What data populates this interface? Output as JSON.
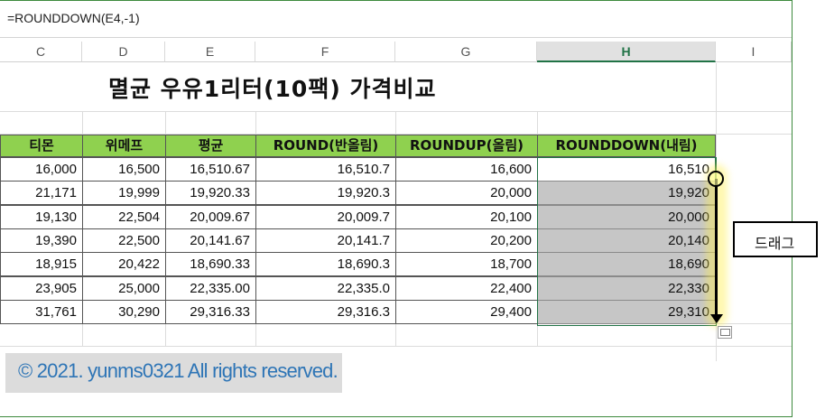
{
  "formula_bar": {
    "text": "=ROUNDDOWN(E4,-1)"
  },
  "columns": [
    {
      "letter": "C"
    },
    {
      "letter": "D"
    },
    {
      "letter": "E"
    },
    {
      "letter": "F"
    },
    {
      "letter": "G"
    },
    {
      "letter": "H",
      "active": true
    },
    {
      "letter": "I"
    }
  ],
  "sheet_title": "멸균 우유1리터(10팩) 가격비교",
  "table": {
    "headers": [
      "티몬",
      "위메프",
      "평균",
      "ROUND(반올림)",
      "ROUNDUP(올림)",
      "ROUNDDOWN(내림)"
    ],
    "rows": [
      [
        "16,000",
        "16,500",
        "16,510.67",
        "16,510.7",
        "16,600",
        "16,510"
      ],
      [
        "21,171",
        "19,999",
        "19,920.33",
        "19,920.3",
        "20,000",
        "19,920"
      ],
      [
        "19,130",
        "22,504",
        "20,009.67",
        "20,009.7",
        "20,100",
        "20,000"
      ],
      [
        "19,390",
        "22,500",
        "20,141.67",
        "20,141.7",
        "20,200",
        "20,140"
      ],
      [
        "18,915",
        "20,422",
        "18,690.33",
        "18,690.3",
        "18,700",
        "18,690"
      ],
      [
        "23,905",
        "25,000",
        "22,335.00",
        "22,335.0",
        "22,400",
        "22,330"
      ],
      [
        "31,761",
        "30,290",
        "29,316.33",
        "29,316.3",
        "29,400",
        "29,310"
      ]
    ]
  },
  "annotation": {
    "callout_text": "드래그"
  },
  "copyright": "© 2021. yunms0321 All rights reserved.",
  "colors": {
    "header_green": "#8fd14f",
    "excel_green": "#217346",
    "selection_gray": "#c6c6c6",
    "copyright_blue": "#2e75b6"
  },
  "icons": {
    "drag_handle": "fill-handle-circle-icon",
    "paste_options": "paste-options-icon"
  }
}
